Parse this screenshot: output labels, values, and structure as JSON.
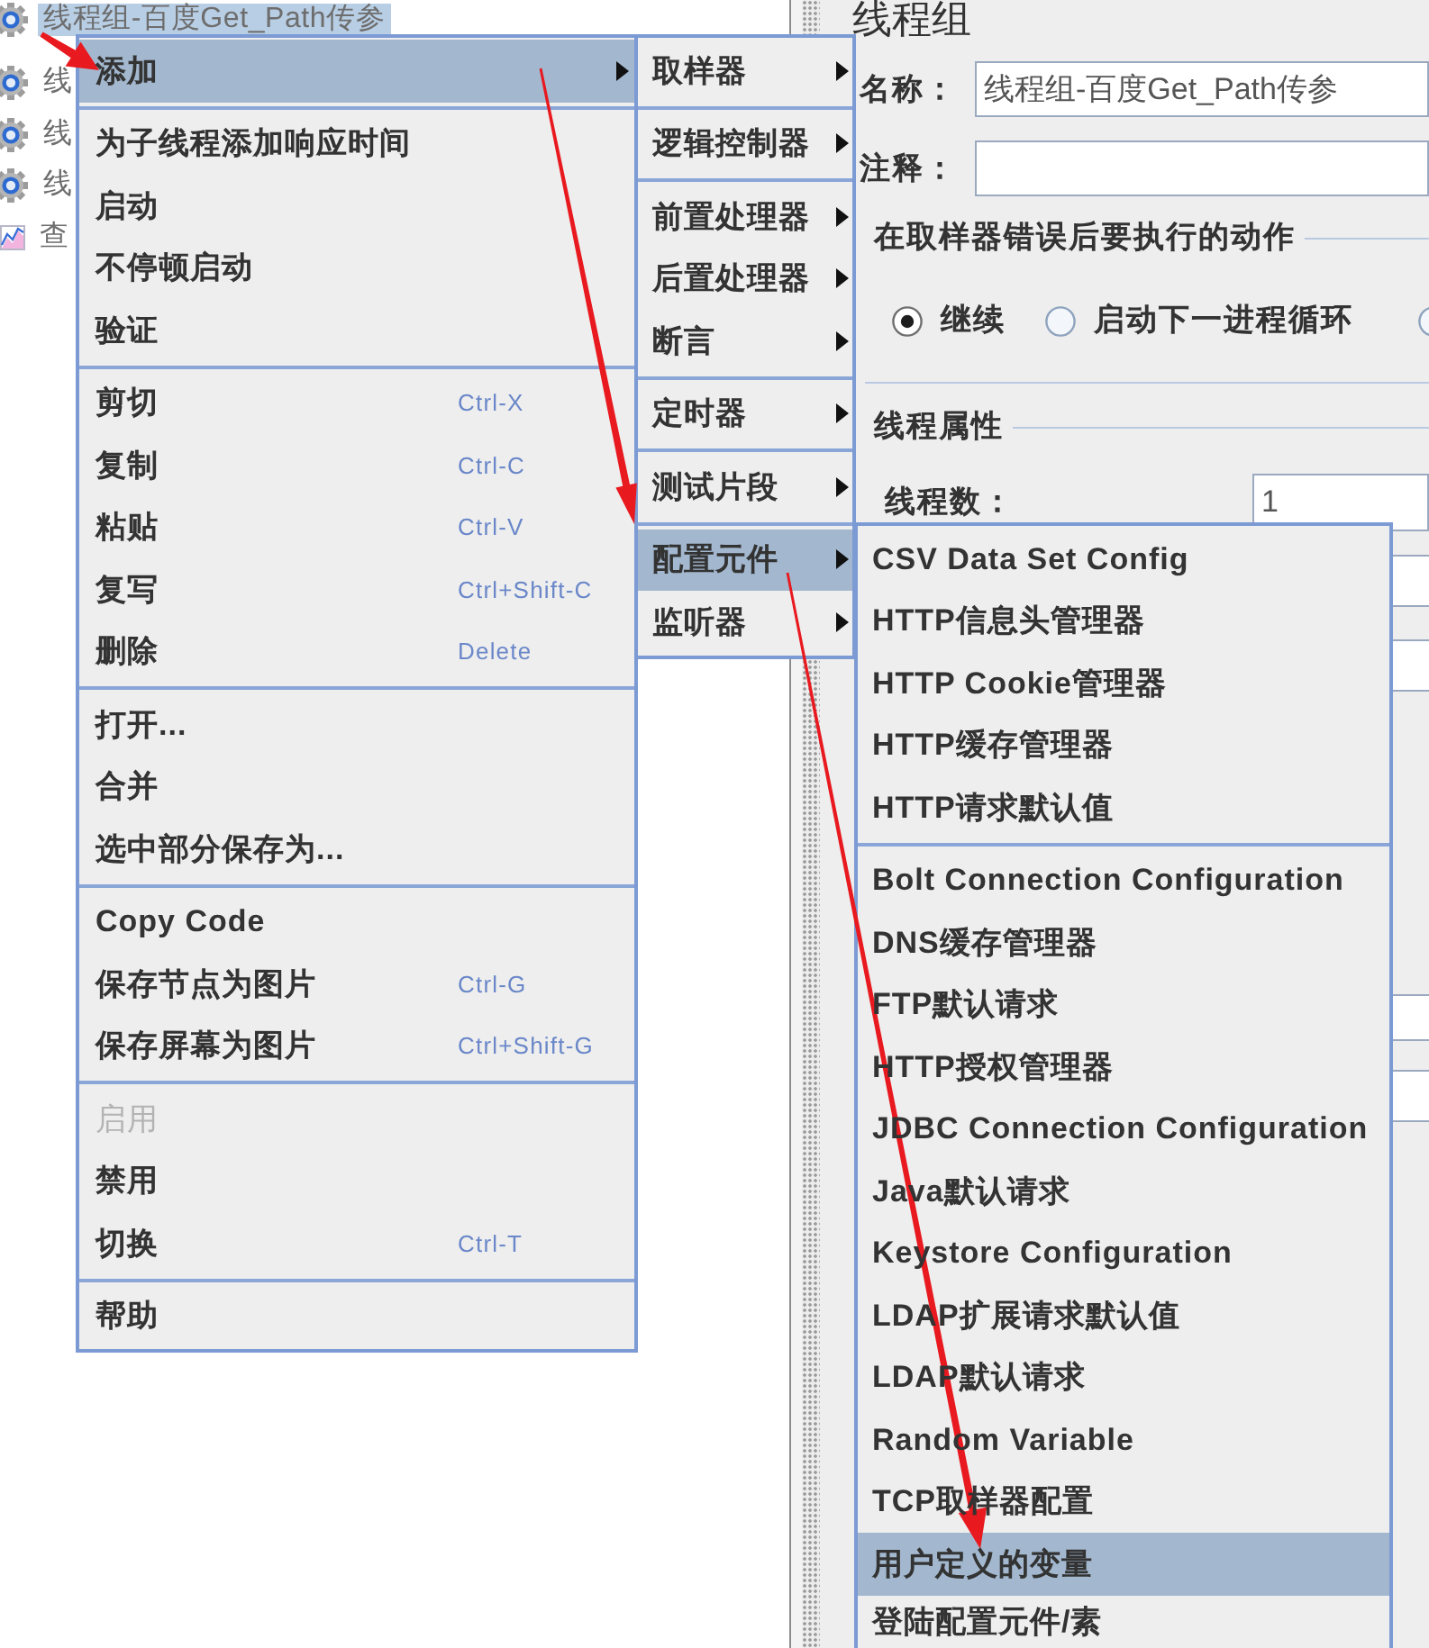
{
  "tree": {
    "items": [
      {
        "kind": "thread-group",
        "label": "线程组-百度Get_Path传参",
        "selected": true
      },
      {
        "kind": "thread-group",
        "label": "线",
        "selected": false
      },
      {
        "kind": "thread-group",
        "label": "线",
        "selected": false
      },
      {
        "kind": "thread-group",
        "label": "线",
        "selected": false
      },
      {
        "kind": "listener",
        "label": "查",
        "selected": false
      }
    ]
  },
  "thread_group_panel": {
    "title": "线程组",
    "name_label": "名称：",
    "name_value": "线程组-百度Get_Path传参",
    "comment_label": "注释：",
    "error_action": {
      "title": "在取样器错误后要执行的动作",
      "options": [
        {
          "label": "继续",
          "selected": true
        },
        {
          "label": "启动下一进程循环",
          "selected": false
        },
        {
          "selected": false
        }
      ]
    },
    "thread_properties": {
      "title": "线程属性",
      "fields": [
        {
          "label": "线程数：",
          "value": "1"
        }
      ]
    }
  },
  "context_menu": {
    "sections": [
      [
        {
          "label": "添加",
          "submenu": true,
          "selected": true,
          "disabled": false
        }
      ],
      [
        {
          "label": "为子线程添加响应时间",
          "submenu": false,
          "selected": false,
          "disabled": false
        },
        {
          "label": "启动",
          "submenu": false,
          "selected": false,
          "disabled": false
        },
        {
          "label": "不停顿启动",
          "submenu": false,
          "selected": false,
          "disabled": false
        },
        {
          "label": "验证",
          "submenu": false,
          "selected": false,
          "disabled": false
        }
      ],
      [
        {
          "label": "剪切",
          "shortcut": "Ctrl-X",
          "submenu": false,
          "selected": false,
          "disabled": false
        },
        {
          "label": "复制",
          "shortcut": "Ctrl-C",
          "submenu": false,
          "selected": false,
          "disabled": false
        },
        {
          "label": "粘贴",
          "shortcut": "Ctrl-V",
          "submenu": false,
          "selected": false,
          "disabled": false
        },
        {
          "label": "复写",
          "shortcut": "Ctrl+Shift-C",
          "submenu": false,
          "selected": false,
          "disabled": false
        },
        {
          "label": "删除",
          "shortcut": "Delete",
          "submenu": false,
          "selected": false,
          "disabled": false
        }
      ],
      [
        {
          "label": "打开...",
          "submenu": false,
          "selected": false,
          "disabled": false
        },
        {
          "label": "合并",
          "submenu": false,
          "selected": false,
          "disabled": false
        },
        {
          "label": "选中部分保存为...",
          "submenu": false,
          "selected": false,
          "disabled": false
        }
      ],
      [
        {
          "label": "Copy Code",
          "submenu": false,
          "selected": false,
          "disabled": false
        },
        {
          "label": "保存节点为图片",
          "shortcut": "Ctrl-G",
          "submenu": false,
          "selected": false,
          "disabled": false
        },
        {
          "label": "保存屏幕为图片",
          "shortcut": "Ctrl+Shift-G",
          "submenu": false,
          "selected": false,
          "disabled": false
        }
      ],
      [
        {
          "label": "启用",
          "submenu": false,
          "selected": false,
          "disabled": true
        },
        {
          "label": "禁用",
          "submenu": false,
          "selected": false,
          "disabled": false
        },
        {
          "label": "切换",
          "shortcut": "Ctrl-T",
          "submenu": false,
          "selected": false,
          "disabled": false
        }
      ],
      [
        {
          "label": "帮助",
          "submenu": false,
          "selected": false,
          "disabled": false
        }
      ]
    ]
  },
  "add_submenu": {
    "sections": [
      [
        {
          "label": "取样器",
          "submenu": true,
          "selected": false
        }
      ],
      [
        {
          "label": "逻辑控制器",
          "submenu": true,
          "selected": false
        }
      ],
      [
        {
          "label": "前置处理器",
          "submenu": true,
          "selected": false
        },
        {
          "label": "后置处理器",
          "submenu": true,
          "selected": false
        },
        {
          "label": "断言",
          "submenu": true,
          "selected": false
        }
      ],
      [
        {
          "label": "定时器",
          "submenu": true,
          "selected": false
        }
      ],
      [
        {
          "label": "测试片段",
          "submenu": true,
          "selected": false
        }
      ],
      [
        {
          "label": "配置元件",
          "submenu": true,
          "selected": true
        },
        {
          "label": "监听器",
          "submenu": true,
          "selected": false
        }
      ]
    ]
  },
  "config_element_submenu": {
    "sections": [
      [
        {
          "label": "CSV Data Set Config",
          "selected": false
        },
        {
          "label": "HTTP信息头管理器",
          "selected": false
        },
        {
          "label": "HTTP Cookie管理器",
          "selected": false
        },
        {
          "label": "HTTP缓存管理器",
          "selected": false
        },
        {
          "label": "HTTP请求默认值",
          "selected": false
        }
      ],
      [
        {
          "label": "Bolt Connection Configuration",
          "selected": false
        },
        {
          "label": "DNS缓存管理器",
          "selected": false
        },
        {
          "label": "FTP默认请求",
          "selected": false
        },
        {
          "label": "HTTP授权管理器",
          "selected": false
        },
        {
          "label": "JDBC Connection Configuration",
          "selected": false
        },
        {
          "label": "Java默认请求",
          "selected": false
        },
        {
          "label": "Keystore Configuration",
          "selected": false
        },
        {
          "label": "LDAP扩展请求默认值",
          "selected": false
        },
        {
          "label": "LDAP默认请求",
          "selected": false
        },
        {
          "label": "Random Variable",
          "selected": false
        },
        {
          "label": "TCP取样器配置",
          "selected": false
        },
        {
          "label": "用户定义的变量",
          "selected": true
        },
        {
          "label": "登陆配置元件/素",
          "selected": false
        }
      ]
    ]
  }
}
